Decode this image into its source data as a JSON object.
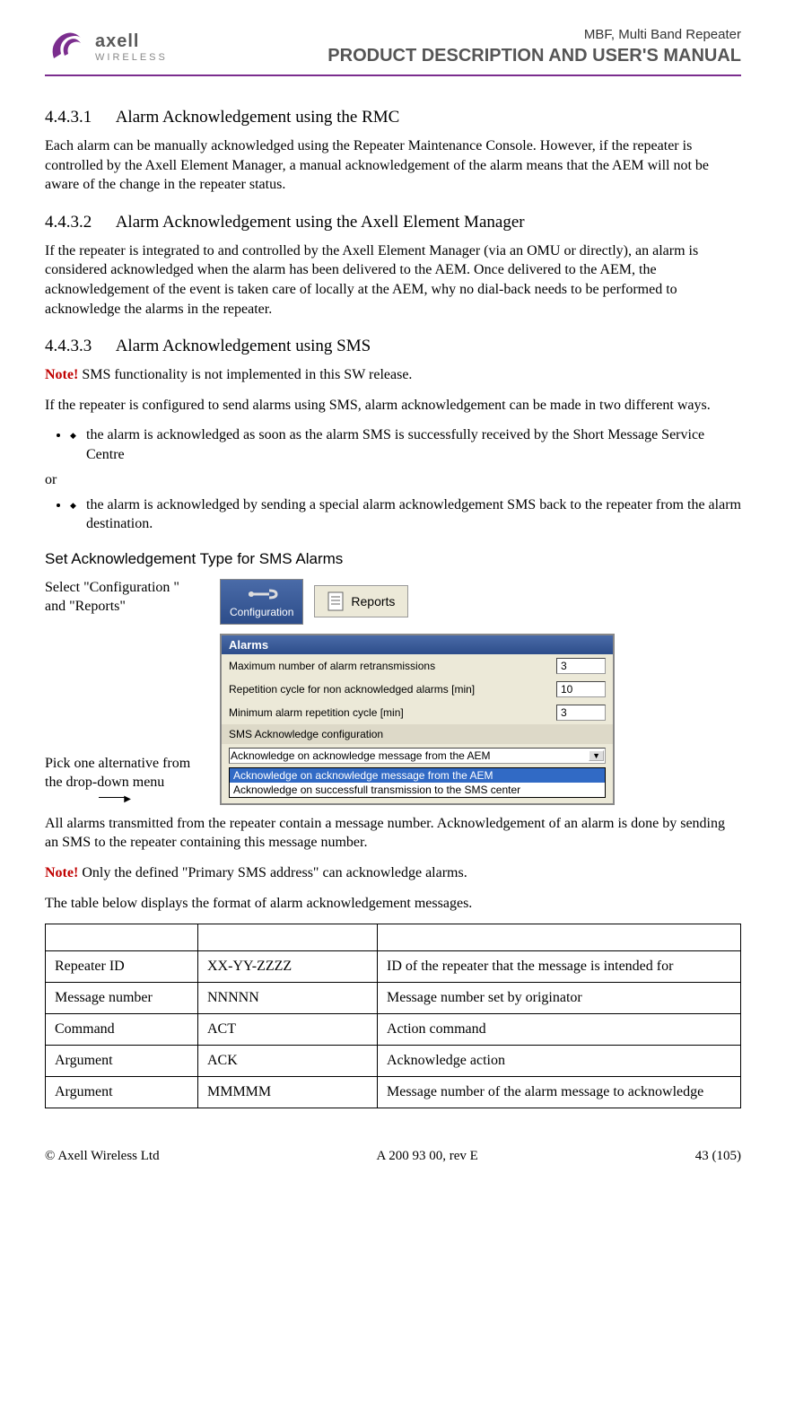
{
  "header": {
    "logo_brand": "axell",
    "logo_sub": "WIRELESS",
    "product": "MBF, Multi Band Repeater",
    "title": "PRODUCT DESCRIPTION AND USER'S MANUAL"
  },
  "sections": {
    "s1": {
      "num": "4.4.3.1",
      "title": "Alarm Acknowledgement using the RMC"
    },
    "s1_body": "Each alarm can be manually acknowledged using the Repeater Maintenance Console. However, if the repeater is controlled by the Axell Element Manager, a manual acknowledgement of the alarm means that the AEM will not be aware of the change in the repeater status.",
    "s2": {
      "num": "4.4.3.2",
      "title": "Alarm Acknowledgement using the Axell Element Manager"
    },
    "s2_body": "If the repeater is integrated to and controlled by the Axell Element Manager (via an OMU or directly), an alarm is considered acknowledged when the alarm has been delivered to the AEM. Once delivered to the AEM, the acknowledgement of the event is taken care of locally at the AEM, why no dial-back needs to be performed to acknowledge the alarms in the repeater.",
    "s3": {
      "num": "4.4.3.3",
      "title": "Alarm Acknowledgement using SMS"
    },
    "s3_note_label": "Note!",
    "s3_note": " SMS functionality is not implemented in this SW release.",
    "s3_body1": "If the repeater is configured to send alarms using SMS, alarm acknowledgement can be made in two different ways.",
    "s3_bullet1": "the alarm is acknowledged as soon as the alarm SMS is successfully received by the Short Message Service Centre",
    "s3_or": "or",
    "s3_bullet2": "the alarm is acknowledged by sending a special alarm acknowledgement SMS back to the repeater from the alarm destination.",
    "subheading": "Set Acknowledgement Type for SMS Alarms",
    "step1_label": "Select \"Configuration \" and \"Reports\"",
    "config_btn": "Configuration",
    "reports_btn": "Reports",
    "step2_label": "Pick one alternative from the drop-down menu",
    "panel": {
      "title": "Alarms",
      "row1_label": "Maximum number of alarm retransmissions",
      "row1_val": "3",
      "row2_label": "Repetition cycle for non acknowledged alarms [min]",
      "row2_val": "10",
      "row3_label": "Minimum alarm repetition cycle [min]",
      "row3_val": "3",
      "subtitle": "SMS Acknowledge configuration",
      "select_val": "Acknowledge on acknowledge message from the AEM",
      "opt1": "Acknowledge on acknowledge message from the AEM",
      "opt2": "Acknowledge on successfull transmission to the SMS center"
    },
    "post1": "All alarms transmitted from the repeater contain a message number. Acknowledgement of an alarm is done by sending an SMS to the repeater containing this message number.",
    "post_note_label": "Note!",
    "post_note": " Only the defined \"Primary SMS address\" can acknowledge alarms.",
    "post2": "The table below displays the format of alarm acknowledgement messages."
  },
  "table": {
    "rows": [
      {
        "c1": "",
        "c2": "",
        "c3": ""
      },
      {
        "c1": "Repeater ID",
        "c2": "XX-YY-ZZZZ",
        "c3": "ID of the repeater that the message is intended for"
      },
      {
        "c1": "Message number",
        "c2": "NNNNN",
        "c3": "Message number set by originator"
      },
      {
        "c1": "Command",
        "c2": "ACT",
        "c3": "Action command"
      },
      {
        "c1": "Argument",
        "c2": "ACK",
        "c3": "Acknowledge action"
      },
      {
        "c1": "Argument",
        "c2": "MMMMM",
        "c3": "Message number of the alarm message to acknowledge"
      }
    ]
  },
  "footer": {
    "left": "© Axell Wireless Ltd",
    "center": "A 200 93 00, rev E",
    "right": "43 (105)"
  }
}
